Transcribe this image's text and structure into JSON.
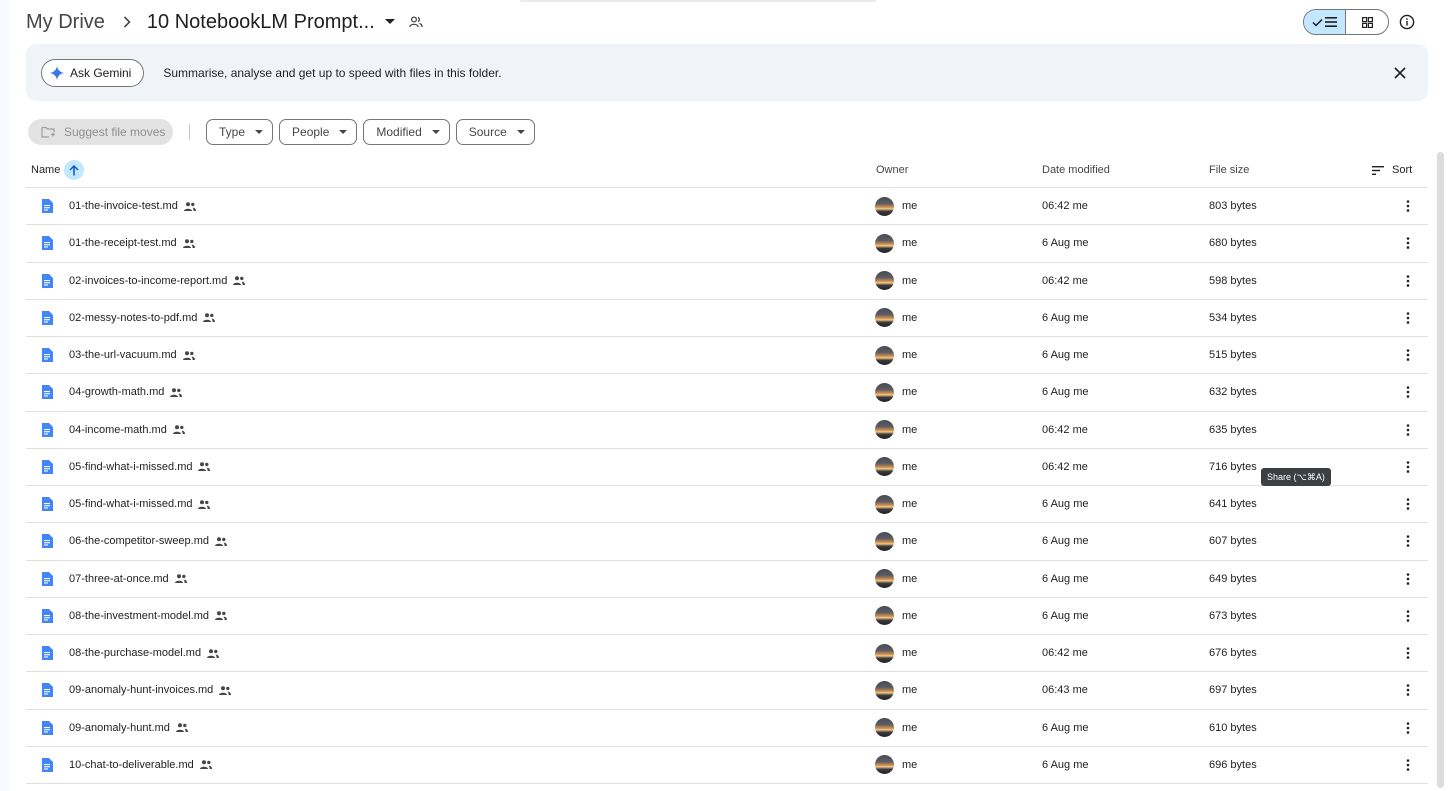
{
  "breadcrumb": {
    "root": "My Drive",
    "separator_icon": "chevron-right-icon",
    "folder": "10 NotebookLM Prompt...",
    "caret_icon": "caret-down-icon",
    "shared_icon": "shared-folder-icon"
  },
  "toolbar": {
    "view_mode": "list",
    "list_icon": "list-view-icon",
    "grid_icon": "grid-view-icon",
    "info_icon": "info-icon"
  },
  "gemini_banner": {
    "button_label": "Ask Gemini",
    "button_icon": "gemini-sparkle-icon",
    "text": "Summarise, analyse and get up to speed with files in this folder.",
    "close_icon": "close-icon"
  },
  "filters": {
    "suggest_label": "Suggest file moves",
    "chips": [
      "Type",
      "People",
      "Modified",
      "Source"
    ]
  },
  "table": {
    "headers": {
      "name": "Name",
      "owner": "Owner",
      "date": "Date modified",
      "size": "File size",
      "sort": "Sort"
    },
    "rows": [
      {
        "name": "01-the-invoice-test.md",
        "owner": "me",
        "date": "06:42 me",
        "size": "803 bytes"
      },
      {
        "name": "01-the-receipt-test.md",
        "owner": "me",
        "date": "6 Aug me",
        "size": "680 bytes"
      },
      {
        "name": "02-invoices-to-income-report.md",
        "owner": "me",
        "date": "06:42 me",
        "size": "598 bytes"
      },
      {
        "name": "02-messy-notes-to-pdf.md",
        "owner": "me",
        "date": "6 Aug me",
        "size": "534 bytes"
      },
      {
        "name": "03-the-url-vacuum.md",
        "owner": "me",
        "date": "6 Aug me",
        "size": "515 bytes"
      },
      {
        "name": "04-growth-math.md",
        "owner": "me",
        "date": "6 Aug me",
        "size": "632 bytes"
      },
      {
        "name": "04-income-math.md",
        "owner": "me",
        "date": "06:42 me",
        "size": "635 bytes"
      },
      {
        "name": "05-find-what-i-missed.md",
        "owner": "me",
        "date": "06:42 me",
        "size": "716 bytes"
      },
      {
        "name": "05-find-what-i-missed.md",
        "owner": "me",
        "date": "6 Aug me",
        "size": "641 bytes"
      },
      {
        "name": "06-the-competitor-sweep.md",
        "owner": "me",
        "date": "6 Aug me",
        "size": "607 bytes"
      },
      {
        "name": "07-three-at-once.md",
        "owner": "me",
        "date": "6 Aug me",
        "size": "649 bytes"
      },
      {
        "name": "08-the-investment-model.md",
        "owner": "me",
        "date": "6 Aug me",
        "size": "673 bytes"
      },
      {
        "name": "08-the-purchase-model.md",
        "owner": "me",
        "date": "06:42 me",
        "size": "676 bytes"
      },
      {
        "name": "09-anomaly-hunt-invoices.md",
        "owner": "me",
        "date": "06:43 me",
        "size": "697 bytes"
      },
      {
        "name": "09-anomaly-hunt.md",
        "owner": "me",
        "date": "6 Aug me",
        "size": "610 bytes"
      },
      {
        "name": "10-chat-to-deliverable.md",
        "owner": "me",
        "date": "6 Aug me",
        "size": "696 bytes"
      }
    ]
  },
  "tooltip": "Share (⌥⌘A)",
  "colors": {
    "accent_selected": "#c2e7ff",
    "doc_icon": "#4285f4",
    "banner_bg": "#f0f4f9"
  }
}
